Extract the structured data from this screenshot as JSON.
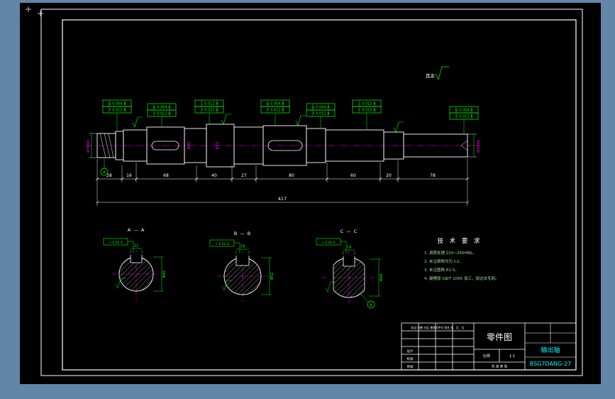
{
  "colors": {
    "window_bg": "#6286a8",
    "canvas_bg": "#000000",
    "line": "#ffffff",
    "accent_green": "#00ff00",
    "accent_magenta": "#ff00ff",
    "accent_cyan": "#00ffff"
  },
  "notes": {
    "rest_label": "其余"
  },
  "main_view": {
    "tolerance_frames": [
      {
        "row1": "◎ 0.004 A",
        "row2": "↗ 0.012 A"
      },
      {
        "row1": "◎ 0.004 A",
        "row2": "↗ 0.012 A"
      },
      {
        "row1": "⊥ 0.012 A",
        "row2": "↗ 0.015 A"
      },
      {
        "row1": "◎ 0.004 A",
        "row2": "↗ 0.012 A"
      },
      {
        "row1": "◎ 0.004 A",
        "row2": "↗ 0.012 A"
      },
      {
        "row1": "⊥ 0.012 A",
        "row2": "↗ 0.015 A"
      },
      {
        "row1": "◎ 0.004 A",
        "row2": "↗ 0.012 A"
      }
    ],
    "dims_chain": [
      "28",
      "16",
      "68",
      "40",
      "27",
      "80",
      "60",
      "20",
      "78"
    ],
    "total": "417",
    "left_dia": "Φ30k6",
    "right_dia": "Φ30k6",
    "dia_mid1": "Φ45",
    "dia_mid2": "Φ52",
    "datum": "A"
  },
  "sections": [
    {
      "label": "A — A",
      "keyway_width": "12",
      "diameter": "Φ45",
      "frame": "↗ 0.02 A"
    },
    {
      "label": "B — B",
      "keyway_width": "14",
      "diameter": "Φ52",
      "frame": "↗ 0.02 A"
    },
    {
      "label": "C — C",
      "keyway_width": "14",
      "diameter": "Φ40",
      "frame": "↗ 0.02 A",
      "datum": "B"
    }
  ],
  "tech_req": {
    "title": "技 术 要 求",
    "lines": [
      "1. 调质处理 220~250HBS。",
      "2. 未注倒角均为 C2。",
      "3. 未注圆角 R1.5。",
      "4. 键槽按 GB/T 1095 加工，锐边去毛刺。"
    ]
  },
  "title_block": {
    "doc_type": "零件图",
    "part_name": "输出轴",
    "drawing_no": "BSG7DANG-27",
    "rev_header": "标记 处数 分区 更改文件号 签名 年、月、日",
    "design": "设计",
    "check": "校核",
    "audit": "审核",
    "scale_label": "比例",
    "scale": "1:1",
    "sheet": "共 张 第 张"
  }
}
